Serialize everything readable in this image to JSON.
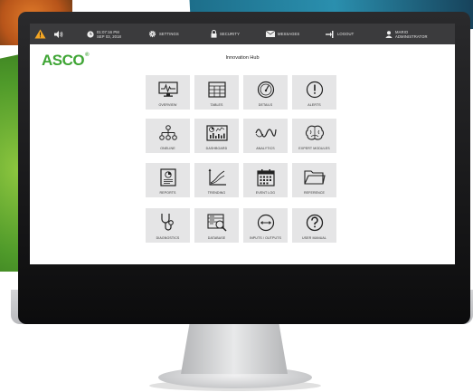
{
  "topbar": {
    "time": "01:07:16 PM",
    "date": "SEP 03, 2018",
    "settings": "SETTINGS",
    "security": "SECURITY",
    "messages": "MESSAGES",
    "logout": "LOGOUT",
    "user_name": "MARIO",
    "user_role": "ADMINISTRATOR"
  },
  "brand": {
    "name": "ASCO",
    "mark": "®",
    "color": "#3fa535"
  },
  "page": {
    "title": "Innovation Hub"
  },
  "tiles": [
    {
      "label": "OVERVIEW",
      "icon": "monitor-pulse-icon"
    },
    {
      "label": "TABLES",
      "icon": "table-icon"
    },
    {
      "label": "DETAILS",
      "icon": "gauge-icon"
    },
    {
      "label": "ALERTS",
      "icon": "alert-circle-icon"
    },
    {
      "label": "ONELINE",
      "icon": "hierarchy-icon"
    },
    {
      "label": "DASHBOARD",
      "icon": "dashboard-icon"
    },
    {
      "label": "ANALYTICS",
      "icon": "waveform-icon"
    },
    {
      "label": "EXPERT MODULES",
      "icon": "brain-icon"
    },
    {
      "label": "REPORTS",
      "icon": "report-icon"
    },
    {
      "label": "TRENDING",
      "icon": "trend-chart-icon"
    },
    {
      "label": "EVENT LOG",
      "icon": "calendar-icon"
    },
    {
      "label": "REFERENCE",
      "icon": "folder-icon"
    },
    {
      "label": "DIAGNOSTICS",
      "icon": "stethoscope-icon"
    },
    {
      "label": "DATABASE",
      "icon": "database-search-icon"
    },
    {
      "label": "INPUTS / OUTPUTS",
      "icon": "arrows-horizontal-icon"
    },
    {
      "label": "USER MANUAL",
      "icon": "help-circle-icon"
    }
  ],
  "colors": {
    "topbar": "#3b3b3d",
    "tile": "#e5e5e6",
    "warning": "#f5a623"
  }
}
